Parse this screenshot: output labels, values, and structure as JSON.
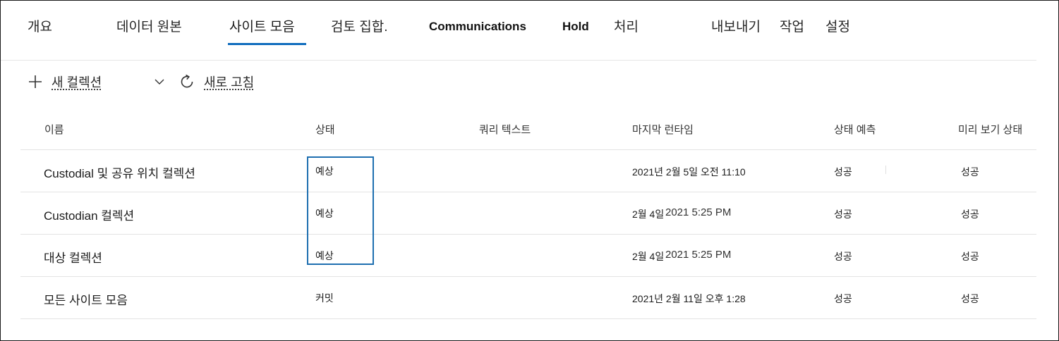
{
  "nav": {
    "tabs": [
      {
        "label": "개요"
      },
      {
        "label": "데이터 원본"
      },
      {
        "label": "사이트 모음"
      },
      {
        "label": "검토 집합."
      },
      {
        "label": "Communications"
      },
      {
        "label": "Hold"
      },
      {
        "label": "처리"
      },
      {
        "label": "내보내기"
      },
      {
        "label": "작업"
      },
      {
        "label": "설정"
      }
    ],
    "active_tab": "사이트 모음",
    "accent_color": "#0f6cbd"
  },
  "toolbar": {
    "new_collection_label": "새 컬렉션",
    "refresh_label": "새로 고침",
    "icons": [
      "plus-icon",
      "chevron-down-icon",
      "refresh-icon"
    ]
  },
  "table": {
    "columns": [
      "이름",
      "상태",
      "쿼리 텍스트",
      "마지막 런타임",
      "상태 예측",
      "미리 보기 상태"
    ],
    "rows": [
      {
        "name": "Custodial 및 공유 위치 컬렉션",
        "status": "예상",
        "query": "",
        "last_run": "2021년 2월 5일 오전 11:10",
        "estimate": "성공",
        "preview": "성공"
      },
      {
        "name": "Custodian 컬렉션",
        "status": "예상",
        "query": "",
        "last_run_a": "2월 4일",
        "last_run_b": "2021 5:25 PM",
        "estimate": "성공",
        "preview": "성공"
      },
      {
        "name": "대상 컬렉션",
        "status": "예상",
        "query": "",
        "last_run_a": "2월 4일",
        "last_run_b": "2021 5:25 PM",
        "estimate": "성공",
        "preview": "성공"
      },
      {
        "name": "모든 사이트 모음",
        "status": "커밋",
        "query": "",
        "last_run": "2021년 2월 11일 오후 1:28",
        "estimate": "성공",
        "preview": "성공"
      }
    ],
    "highlight_color": "#1e6fb0"
  }
}
